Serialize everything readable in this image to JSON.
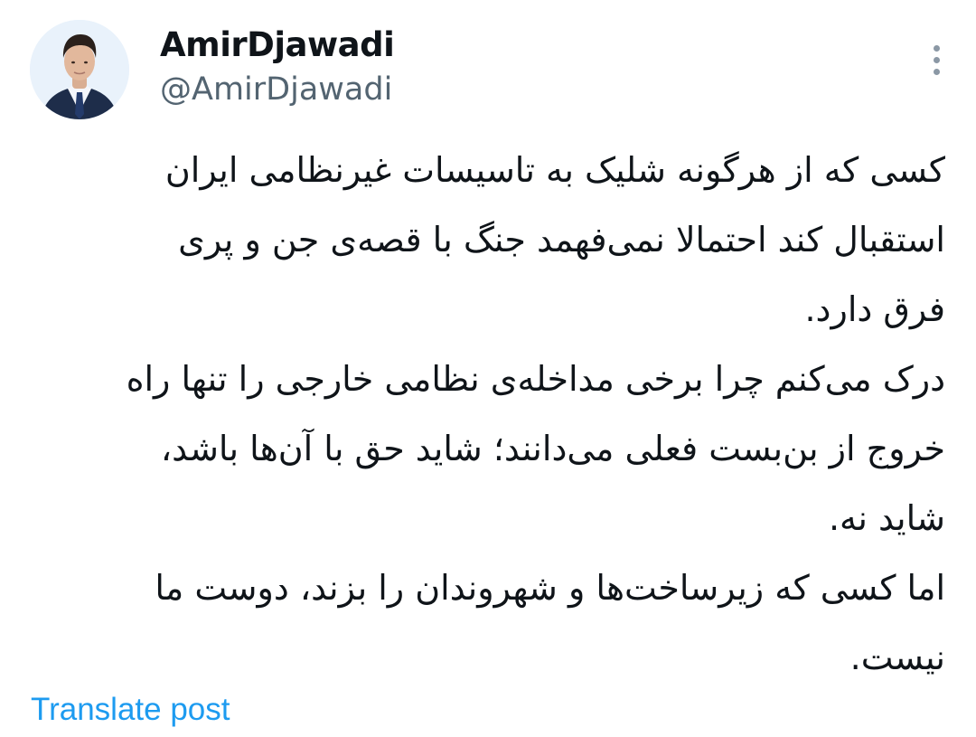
{
  "author": {
    "display_name": "AmirDjawadi",
    "handle": "@AmirDjawadi",
    "avatar_icon": "profile-photo"
  },
  "more_icon": "more-vertical-icon",
  "tweet": {
    "lines": [
      "کسی که از هرگونه شلیک به تاسیسات غیرنظامی ایران",
      "استقبال کند احتمالا نمی‌فهمد جنگ با قصه‌ی جن و پری",
      "فرق دارد.",
      "درک می‌کنم چرا برخی مداخله‌ی نظامی خارجی را تنها راه",
      "خروج از بن‌بست فعلی می‌دانند؛ شاید حق با آن‌ها باشد،",
      "شاید نه.",
      "اما کسی که زیرساخت‌ها و شهروندان را بزند، دوست ما",
      "نیست."
    ]
  },
  "translate_label": "Translate post",
  "colors": {
    "text": "#0f1419",
    "secondary": "#536471",
    "link": "#1d9bf0"
  }
}
